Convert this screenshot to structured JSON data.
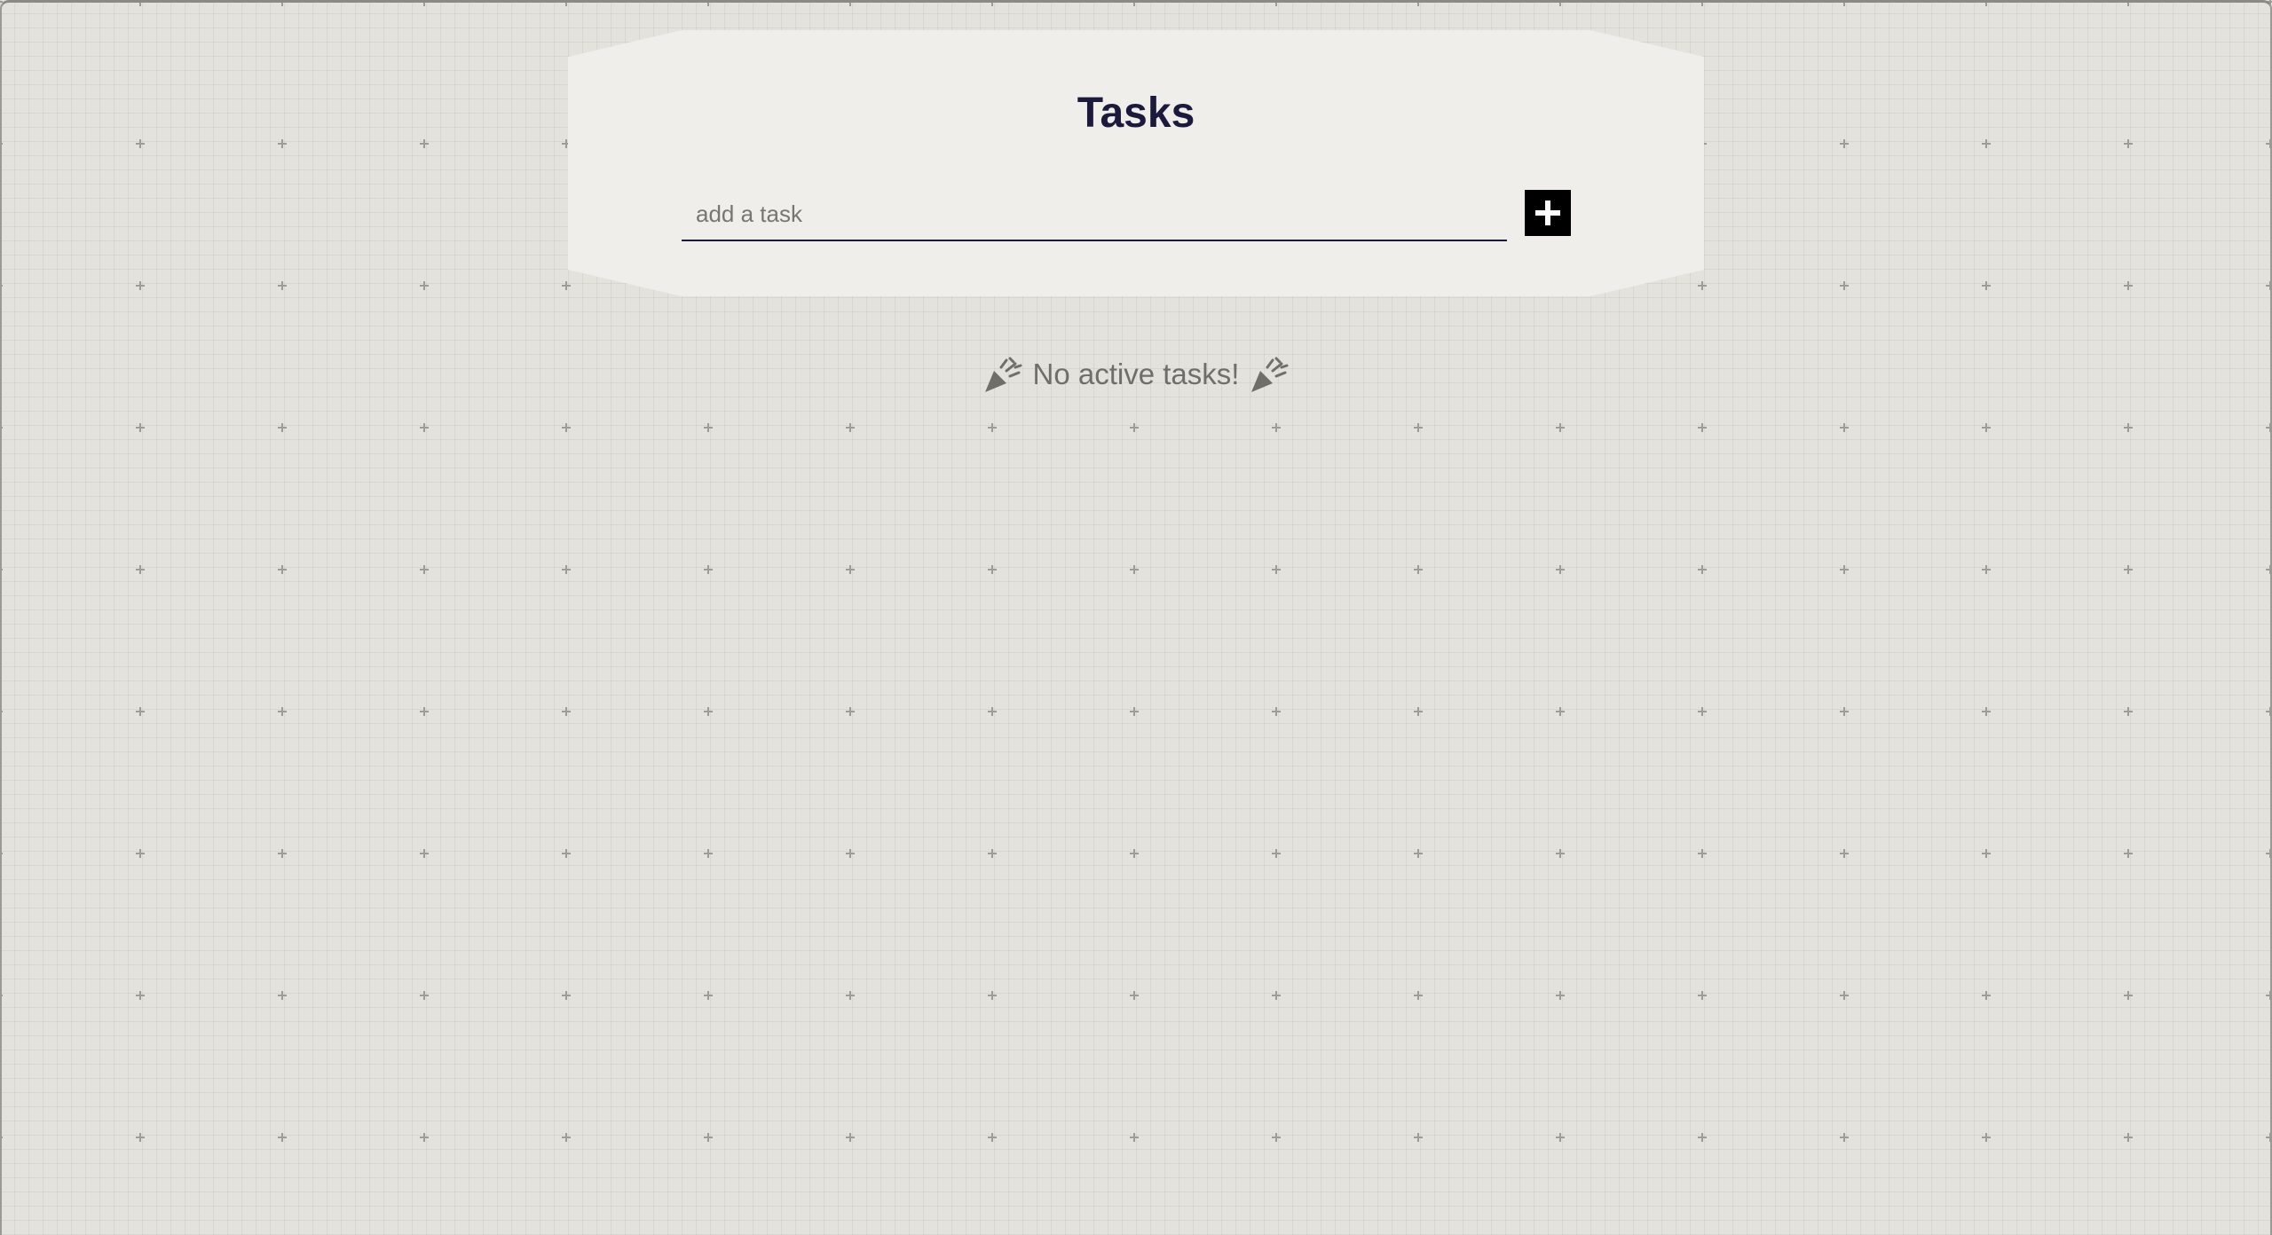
{
  "app": {
    "title": "Tasks"
  },
  "task_form": {
    "input_value": "",
    "input_placeholder": "add a task",
    "add_button_icon": "plus-icon"
  },
  "empty_state": {
    "message": "No active tasks!",
    "left_icon": "party-popper-icon",
    "right_icon": "party-popper-icon"
  },
  "colors": {
    "background": "#e3e2dd",
    "panel": "#f0eeea",
    "title": "#1c1a3c",
    "button": "#000000",
    "muted_text": "#6f6e6a"
  }
}
